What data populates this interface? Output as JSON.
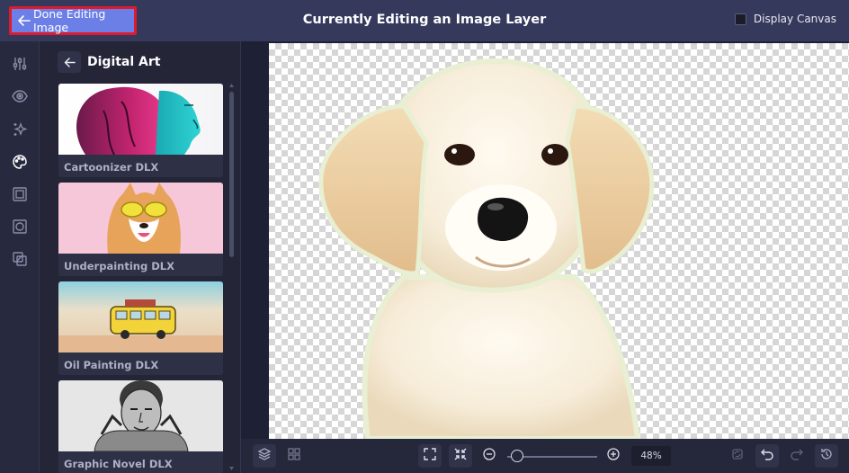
{
  "topbar": {
    "done_label": "Done Editing Image",
    "title": "Currently Editing an Image Layer",
    "display_canvas_label": "Display Canvas",
    "display_canvas_checked": false
  },
  "rail": {
    "icons": [
      "sliders-icon",
      "eye-icon",
      "sparkles-icon",
      "palette-icon",
      "frame-icon",
      "frame-focus-icon",
      "layers-overlap-icon"
    ],
    "active": "palette-icon"
  },
  "panel": {
    "title": "Digital Art",
    "items": [
      {
        "label": "Cartoonizer DLX"
      },
      {
        "label": "Underpainting DLX"
      },
      {
        "label": "Oil Painting DLX"
      },
      {
        "label": "Graphic Novel DLX"
      }
    ]
  },
  "bottombar": {
    "zoom": "48%"
  },
  "colors": {
    "accent": "#6c7fe6",
    "highlight": "#e01a2b",
    "topbar": "#35395c",
    "panel": "#242638"
  }
}
